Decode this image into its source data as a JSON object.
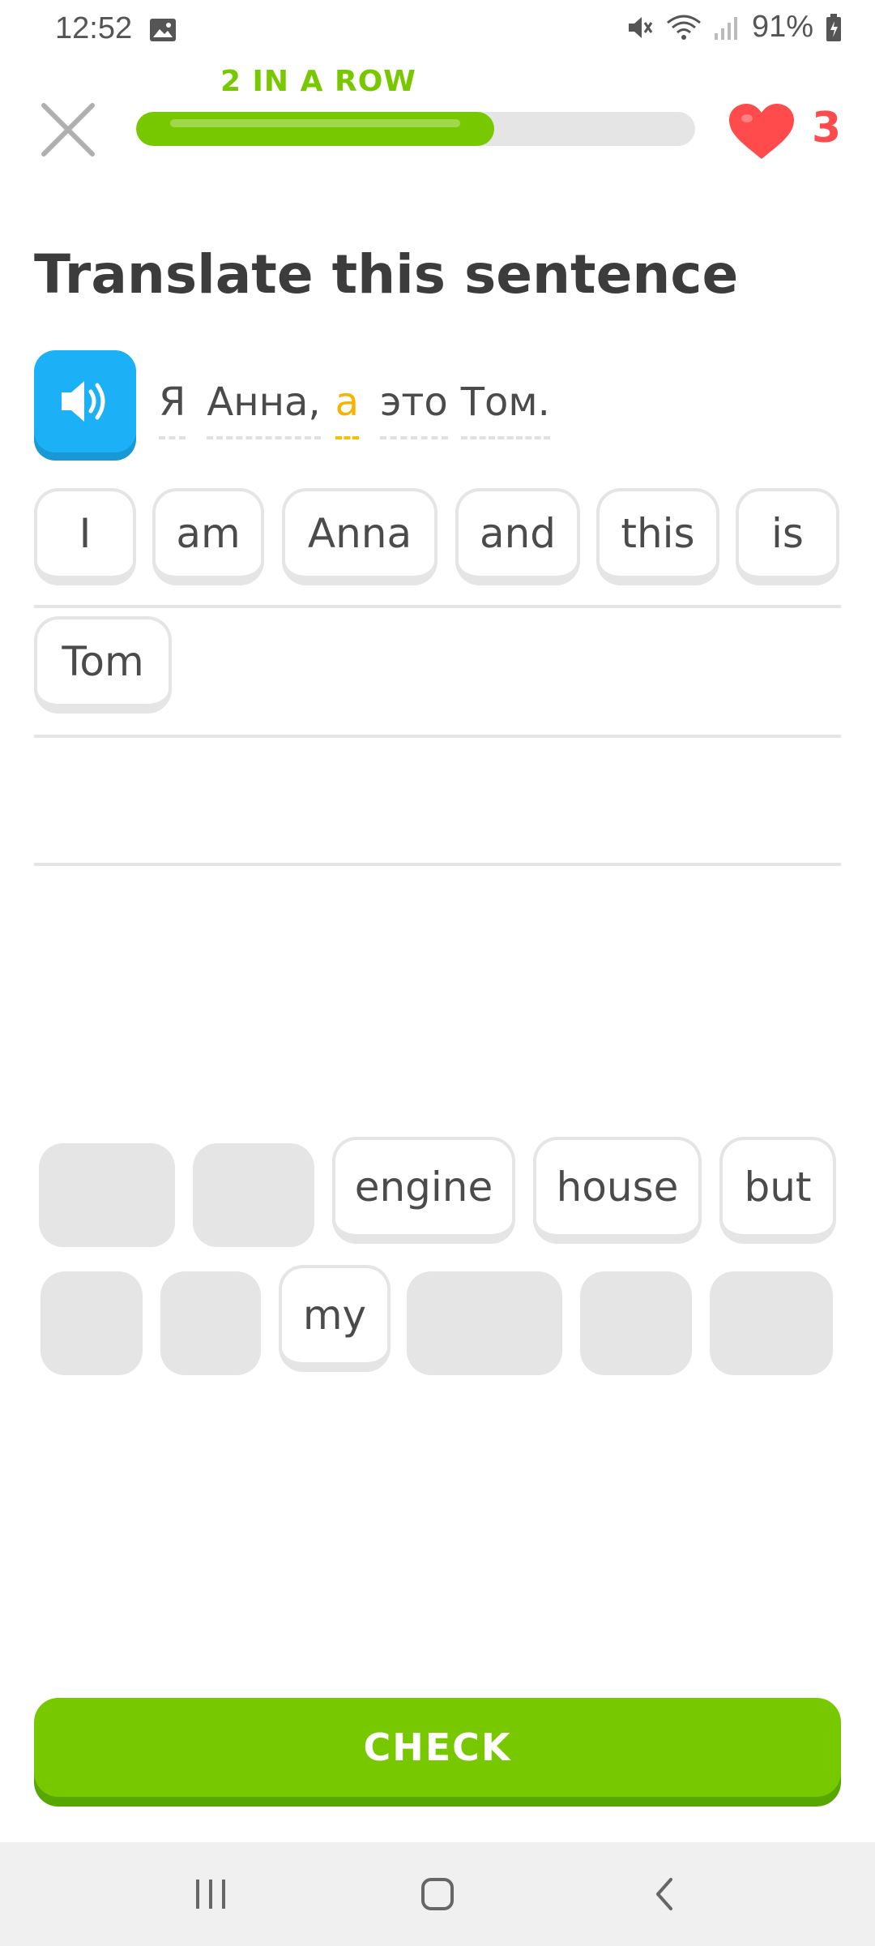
{
  "status_bar": {
    "time": "12:52",
    "battery": "91%"
  },
  "header": {
    "streak_label": "2 IN A ROW",
    "progress": 0.64,
    "hearts": "3",
    "colors": {
      "green": "#78c800",
      "red": "#ff4b4b"
    }
  },
  "title": "Translate this sentence",
  "prompt": {
    "speaker_color": "#1cb0f6",
    "words": [
      "Я",
      "Анна,",
      "а",
      "это",
      "Том."
    ]
  },
  "answer_tiles": [
    "I",
    "am",
    "Anna",
    "and",
    "this",
    "is",
    "Tom"
  ],
  "word_bank": {
    "available": [
      "engine",
      "house",
      "but",
      "my"
    ]
  },
  "check_button": {
    "label": "CHECK",
    "color": "#78c800"
  },
  "nav": {
    "icons": [
      "recent-apps-icon",
      "home-icon",
      "back-icon"
    ]
  }
}
